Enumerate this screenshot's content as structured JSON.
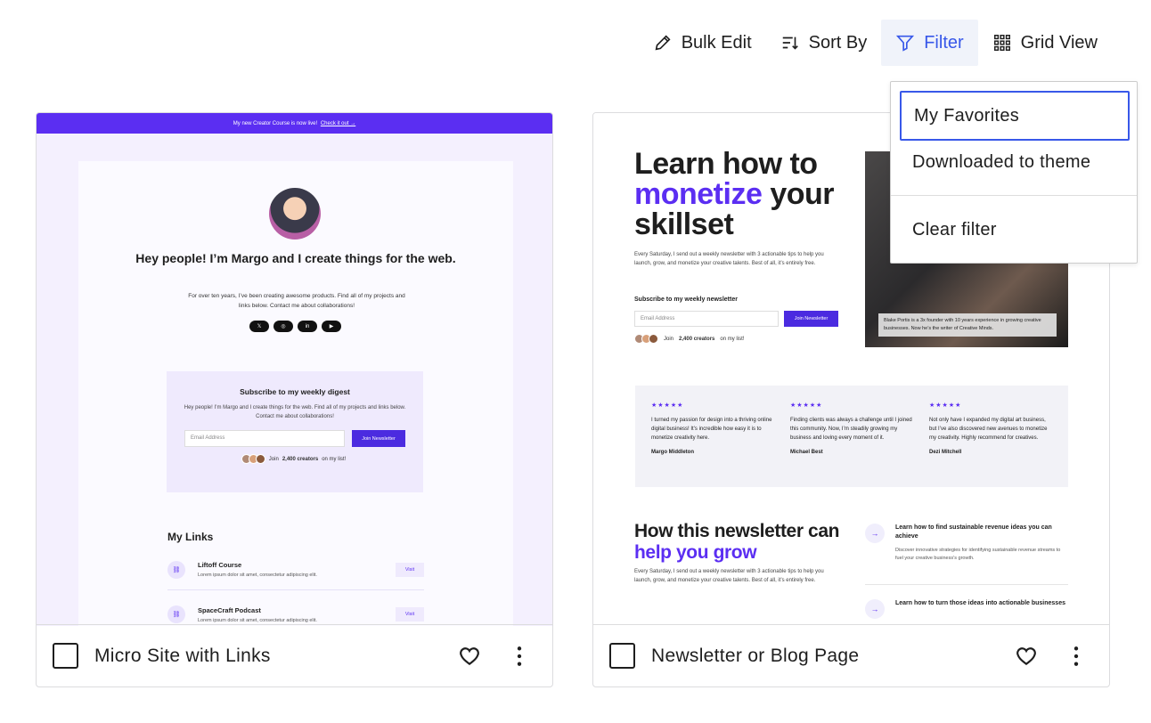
{
  "toolbar": {
    "bulk_edit": "Bulk Edit",
    "sort_by": "Sort By",
    "filter": "Filter",
    "grid_view": "Grid View"
  },
  "filter_menu": {
    "items": [
      "My Favorites",
      "Downloaded to theme"
    ],
    "clear": "Clear filter"
  },
  "cards": [
    {
      "title": "Micro Site with Links",
      "preview": {
        "banner": "My new Creator Course is now live!",
        "banner_link": "Check it out →",
        "heading": "Hey people! I’m Margo and I create things for the web.",
        "intro": "For over ten years, I’ve been creating awesome products. Find all of my projects and links below. Contact me about collaborations!",
        "socials": [
          "𝕏",
          "◎",
          "in",
          "▶"
        ],
        "digest_title": "Subscribe to my weekly digest",
        "digest_text": "Hey people! I’m Margo and I create things for the web. Find all of my projects and links below. Contact me about collaborations!",
        "email_placeholder": "Email Address",
        "join_label": "Join Newsletter",
        "creators_count": "2,400 creators",
        "creators_prefix": "Join",
        "creators_suffix": "on my list!",
        "links_title": "My Links",
        "links": [
          {
            "name": "Liftoff Course",
            "desc": "Lorem ipsum dolor sit amet, consectetur adipiscing elit.",
            "action": "Visit"
          },
          {
            "name": "SpaceCraft Podcast",
            "desc": "Lorem ipsum dolor sit amet, consectetur adipiscing elit.",
            "action": "Visit"
          }
        ]
      }
    },
    {
      "title": "Newsletter or Blog Page",
      "preview": {
        "hero_line1": "Learn how to",
        "hero_accent": "monetize",
        "hero_line2": "your",
        "hero_line3": "skillset",
        "hero_text": "Every Saturday, I send out a weekly newsletter with 3 actionable tips to help you launch, grow, and monetize your creative talents. Best of all, it’s entirely free.",
        "subscribe_title": "Subscribe to my weekly newsletter",
        "email_placeholder": "Email Address",
        "join_label": "Join Newsletter",
        "creators_prefix": "Join",
        "creators_count": "2,400 creators",
        "creators_suffix": "on my list!",
        "photo_caption": "Blake Portis is a 3x founder with 10 years experience in growing creative businesses. Now he’s the writer of Creative Minds.",
        "testimonials": [
          {
            "stars": "★★★★★",
            "quote": "I turned my passion for design into a thriving online digital business! It’s incredible how easy it is to monetize creativity here.",
            "name": "Margo Middleton"
          },
          {
            "stars": "★★★★★",
            "quote": "Finding clients was always a challenge until I joined this community. Now, I’m steadily growing my business and loving every moment of it.",
            "name": "Michael Best"
          },
          {
            "stars": "★★★★★",
            "quote": "Not only have I expanded my digital art business, but I’ve also discovered new avenues to monetize my creativity. Highly recommend for creatives.",
            "name": "Dezi Mitchell"
          }
        ],
        "how_line1": "How this newsletter can",
        "how_accent": "help you grow",
        "how_text": "Every Saturday, I send out a weekly newsletter with 3 actionable tips to help you launch, grow, and monetize your creative talents. Best of all, it’s entirely free.",
        "tips": [
          {
            "title": "Learn how to find sustainable revenue ideas you can achieve",
            "desc": "Discover innovative strategies for identifying sustainable revenue streams to fuel your creative business’s growth."
          },
          {
            "title": "Learn how to turn those ideas into actionable businesses",
            "desc": ""
          }
        ]
      }
    }
  ],
  "colors": {
    "accent": "#3858e9",
    "preview_brand": "#5b2ef2"
  }
}
